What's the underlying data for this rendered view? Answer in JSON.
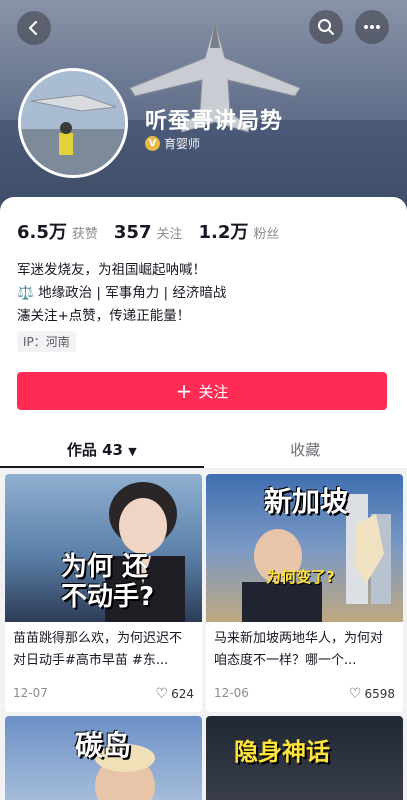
{
  "profile": {
    "name": "听蚕哥讲局势",
    "badge": "育婴师",
    "badge_icon": "verified-v-icon"
  },
  "stats": [
    {
      "value": "6.5万",
      "label": "获赞"
    },
    {
      "value": "357",
      "label": "关注"
    },
    {
      "value": "1.2万",
      "label": "粉丝"
    }
  ],
  "bio": {
    "line1": "军迷发烧友，为祖国崛起呐喊！",
    "line2": "⚖️ 地缘政治 | 军事角力 | 经济暗战",
    "line3": "瀗关注+点赞，传递正能量！"
  },
  "ip": "IP：河南",
  "follow": {
    "label": "关注",
    "color": "#fe2c55"
  },
  "tabs": {
    "works": "作品 43",
    "collection": "收藏"
  },
  "videos": [
    {
      "overlay": "为何 还不动手?",
      "title": "苗苗跳得那么欢，为何迟迟不对日动手#高市早苗 #东...",
      "date": "12-07",
      "likes": "624"
    },
    {
      "overlay_top": "新加坡",
      "overlay_mid": "为何变了?",
      "title": "马来新加坡两地华人，为何对咱态度不一样？哪一个...",
      "date": "12-06",
      "likes": "6598"
    },
    {
      "overlay": "碳岛"
    },
    {
      "overlay": "隐身神话"
    }
  ]
}
